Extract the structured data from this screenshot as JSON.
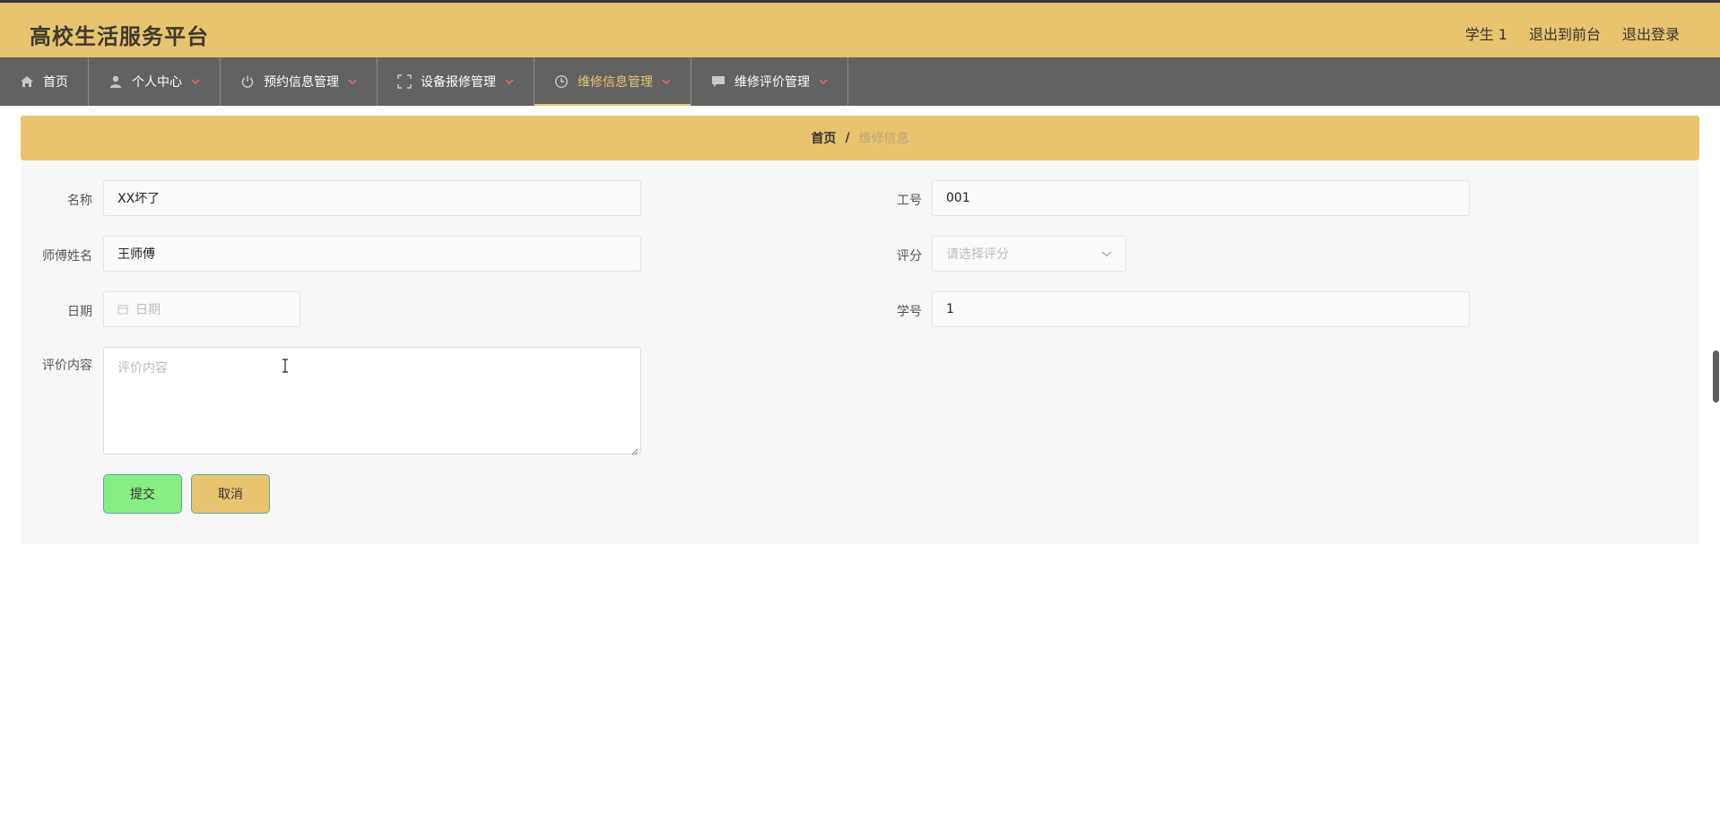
{
  "app": {
    "title": "高校生活服务平台"
  },
  "header": {
    "user": "学生 1",
    "to_front": "退出到前台",
    "logout": "退出登录"
  },
  "nav": [
    {
      "label": "首页",
      "icon": "home-icon",
      "active": false,
      "has_caret": false
    },
    {
      "label": "个人中心",
      "icon": "user-icon",
      "active": false,
      "has_caret": true
    },
    {
      "label": "预约信息管理",
      "icon": "power-icon",
      "active": false,
      "has_caret": true
    },
    {
      "label": "设备报修管理",
      "icon": "fullscreen-icon",
      "active": false,
      "has_caret": true
    },
    {
      "label": "维修信息管理",
      "icon": "clock-icon",
      "active": true,
      "has_caret": true
    },
    {
      "label": "维修评价管理",
      "icon": "message-icon",
      "active": false,
      "has_caret": true
    }
  ],
  "breadcrumb": {
    "home": "首页",
    "separator": "/",
    "current": "维修信息"
  },
  "form": {
    "name_label": "名称",
    "name_value": "XX坏了",
    "worker_id_label": "工号",
    "worker_id_value": "001",
    "master_label": "师傅姓名",
    "master_value": "王师傅",
    "score_label": "评分",
    "score_placeholder": "请选择评分",
    "date_label": "日期",
    "date_placeholder": "日期",
    "student_id_label": "学号",
    "student_id_value": "1",
    "comment_label": "评价内容",
    "comment_placeholder": "评价内容"
  },
  "buttons": {
    "submit": "提交",
    "cancel": "取消"
  },
  "colors": {
    "accent": "#e8c46f",
    "nav_bg": "#636261",
    "submit_bg": "#87ee84"
  }
}
